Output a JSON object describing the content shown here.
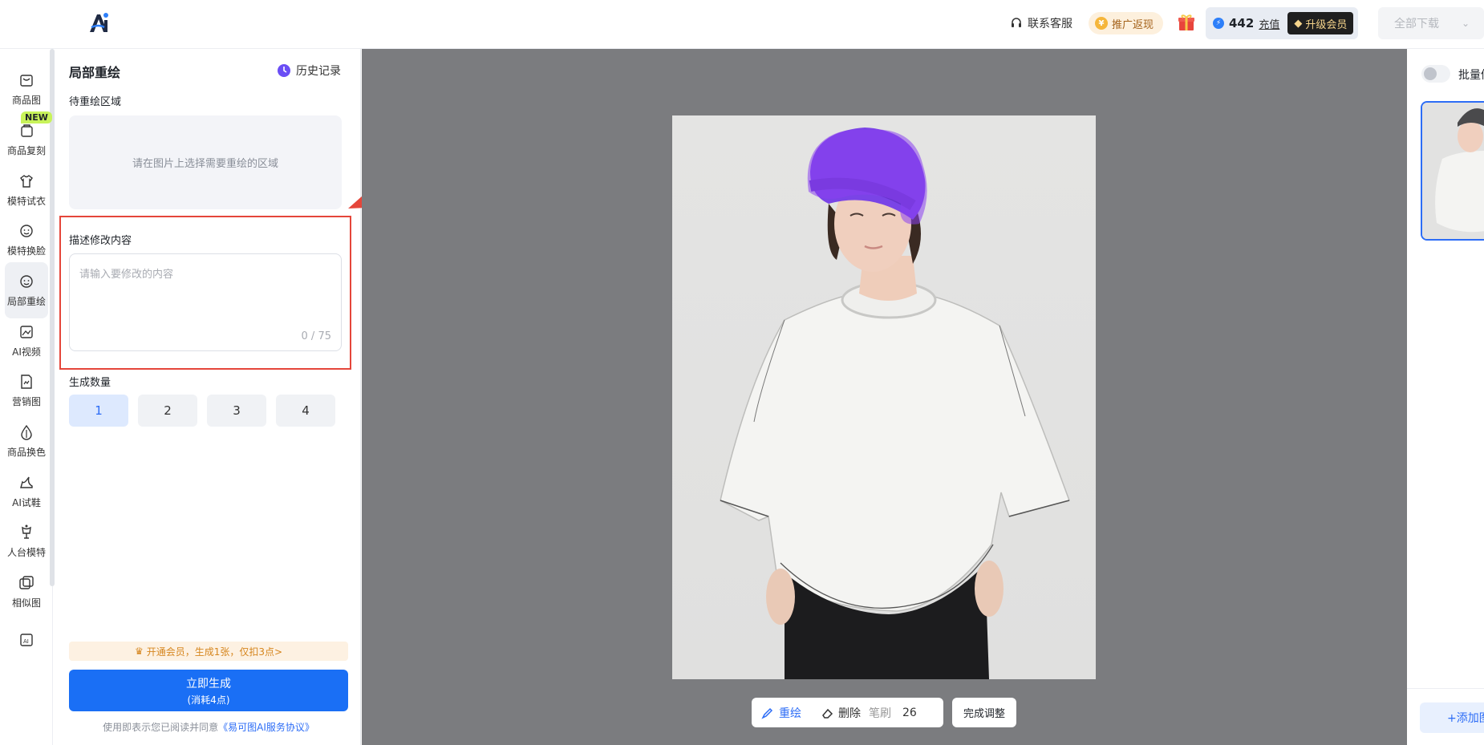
{
  "topbar": {
    "logo_text": "Ai",
    "contact": "联系客服",
    "promo": "推广返现",
    "credits": "442",
    "recharge": "充值",
    "upgrade": "升级会员",
    "download_all": "全部下载"
  },
  "nav": {
    "items": [
      {
        "label": "商品图",
        "icon": "image-bag-icon"
      },
      {
        "label": "商品复刻",
        "icon": "bag-copy-icon"
      },
      {
        "label": "模特试衣",
        "icon": "shirt-icon"
      },
      {
        "label": "模特换脸",
        "icon": "face-swap-icon"
      },
      {
        "label": "局部重绘",
        "icon": "face-redraw-icon"
      },
      {
        "label": "AI视频",
        "icon": "video-icon"
      },
      {
        "label": "营销图",
        "icon": "poster-icon"
      },
      {
        "label": "商品换色",
        "icon": "color-drop-icon"
      },
      {
        "label": "AI试鞋",
        "icon": "shoe-icon"
      },
      {
        "label": "人台模特",
        "icon": "mannequin-icon"
      },
      {
        "label": "相似图",
        "icon": "similar-image-icon"
      },
      {
        "label": "",
        "icon": "ai-expand-icon"
      }
    ],
    "new_badge": "NEW",
    "active_index": 4
  },
  "panel": {
    "title": "局部重绘",
    "history": "历史记录",
    "region_label": "待重绘区域",
    "region_placeholder": "请在图片上选择需要重绘的区域",
    "describe_label": "描述修改内容",
    "describe_placeholder": "请输入要修改的内容",
    "counter": "0 / 75",
    "quantity_label": "生成数量",
    "quantities": [
      "1",
      "2",
      "3",
      "4"
    ],
    "selected_quantity": "1",
    "vip_tip": "开通会员，生成1张，仅扣3点>",
    "generate_main": "立即生成",
    "generate_sub": "(消耗4点)",
    "agreement_prefix": "使用即表示您已阅读并同意",
    "agreement_link": "《易可图AI服务协议》"
  },
  "canvas": {
    "tool_redraw": "重绘",
    "tool_erase": "删除",
    "brush_label": "笔刷",
    "brush_size": "26",
    "finish": "完成调整"
  },
  "right": {
    "batch_label": "批量修改",
    "add_image": "+添加图片"
  },
  "colors": {
    "accent": "#1a6ff5",
    "mask": "#8a3ff0",
    "highlight_frame": "#e5463a",
    "canvas_bg": "#7b7c7f"
  }
}
